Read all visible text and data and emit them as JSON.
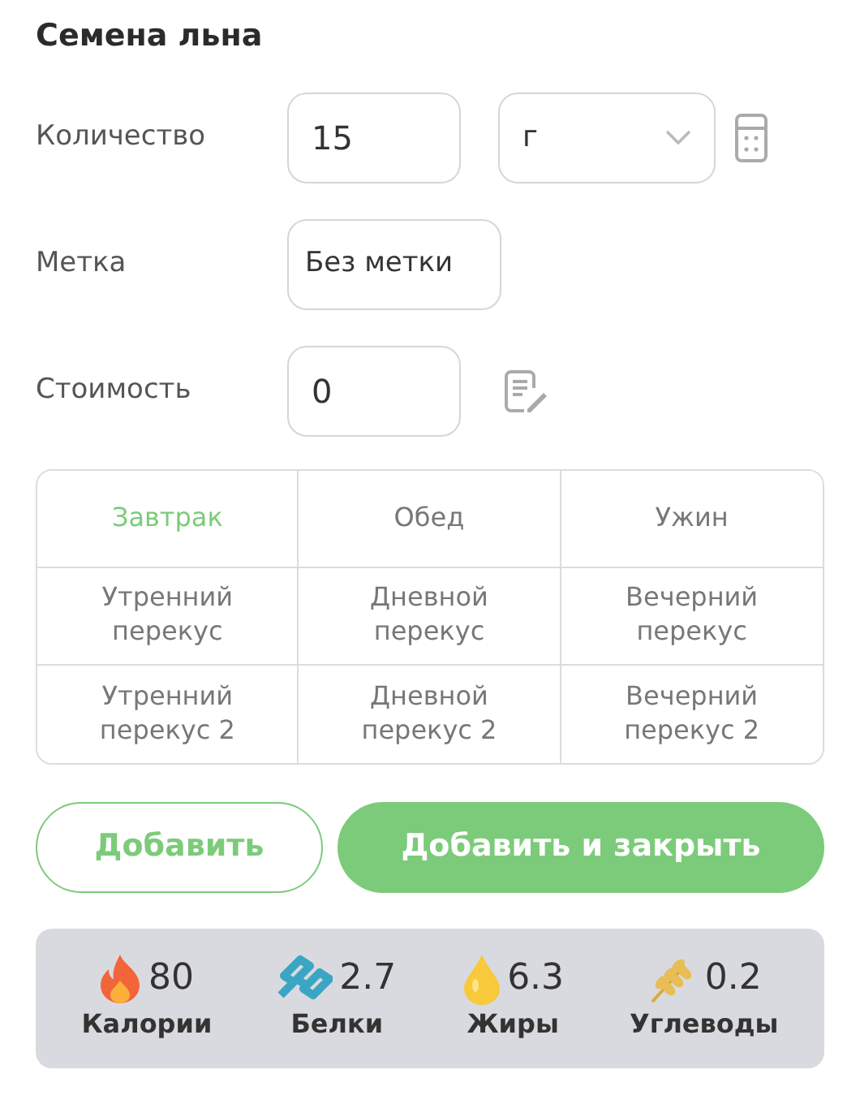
{
  "title": "Семена льна",
  "fields": [
    {
      "label": "Количество",
      "value": "15",
      "unit": "г",
      "kind": "quantity"
    },
    {
      "label": "Метка",
      "value": "Без метки",
      "kind": "tag"
    },
    {
      "label": "Стоимость",
      "value": "0",
      "kind": "cost"
    }
  ],
  "meals": [
    {
      "label": "Завтрак",
      "selected": true
    },
    {
      "label": "Обед",
      "selected": false
    },
    {
      "label": "Ужин",
      "selected": false
    },
    {
      "label": "Утренний перекус",
      "selected": false
    },
    {
      "label": "Дневной перекус",
      "selected": false
    },
    {
      "label": "Вечерний перекус",
      "selected": false
    },
    {
      "label": "Утренний перекус 2",
      "selected": false
    },
    {
      "label": "Дневной перекус 2",
      "selected": false
    },
    {
      "label": "Вечерний перекус 2",
      "selected": false
    }
  ],
  "buttons": [
    {
      "label": "Добавить",
      "kind": "outline"
    },
    {
      "label": "Добавить и закрыть",
      "kind": "primary"
    }
  ],
  "nutrients": [
    {
      "value": "80",
      "label": "Калории",
      "kind": "calories"
    },
    {
      "value": "2.7",
      "label": "Белки",
      "kind": "protein"
    },
    {
      "value": "6.3",
      "label": "Жиры",
      "kind": "fat"
    },
    {
      "value": "0.2",
      "label": "Углеводы",
      "kind": "carbs"
    }
  ]
}
